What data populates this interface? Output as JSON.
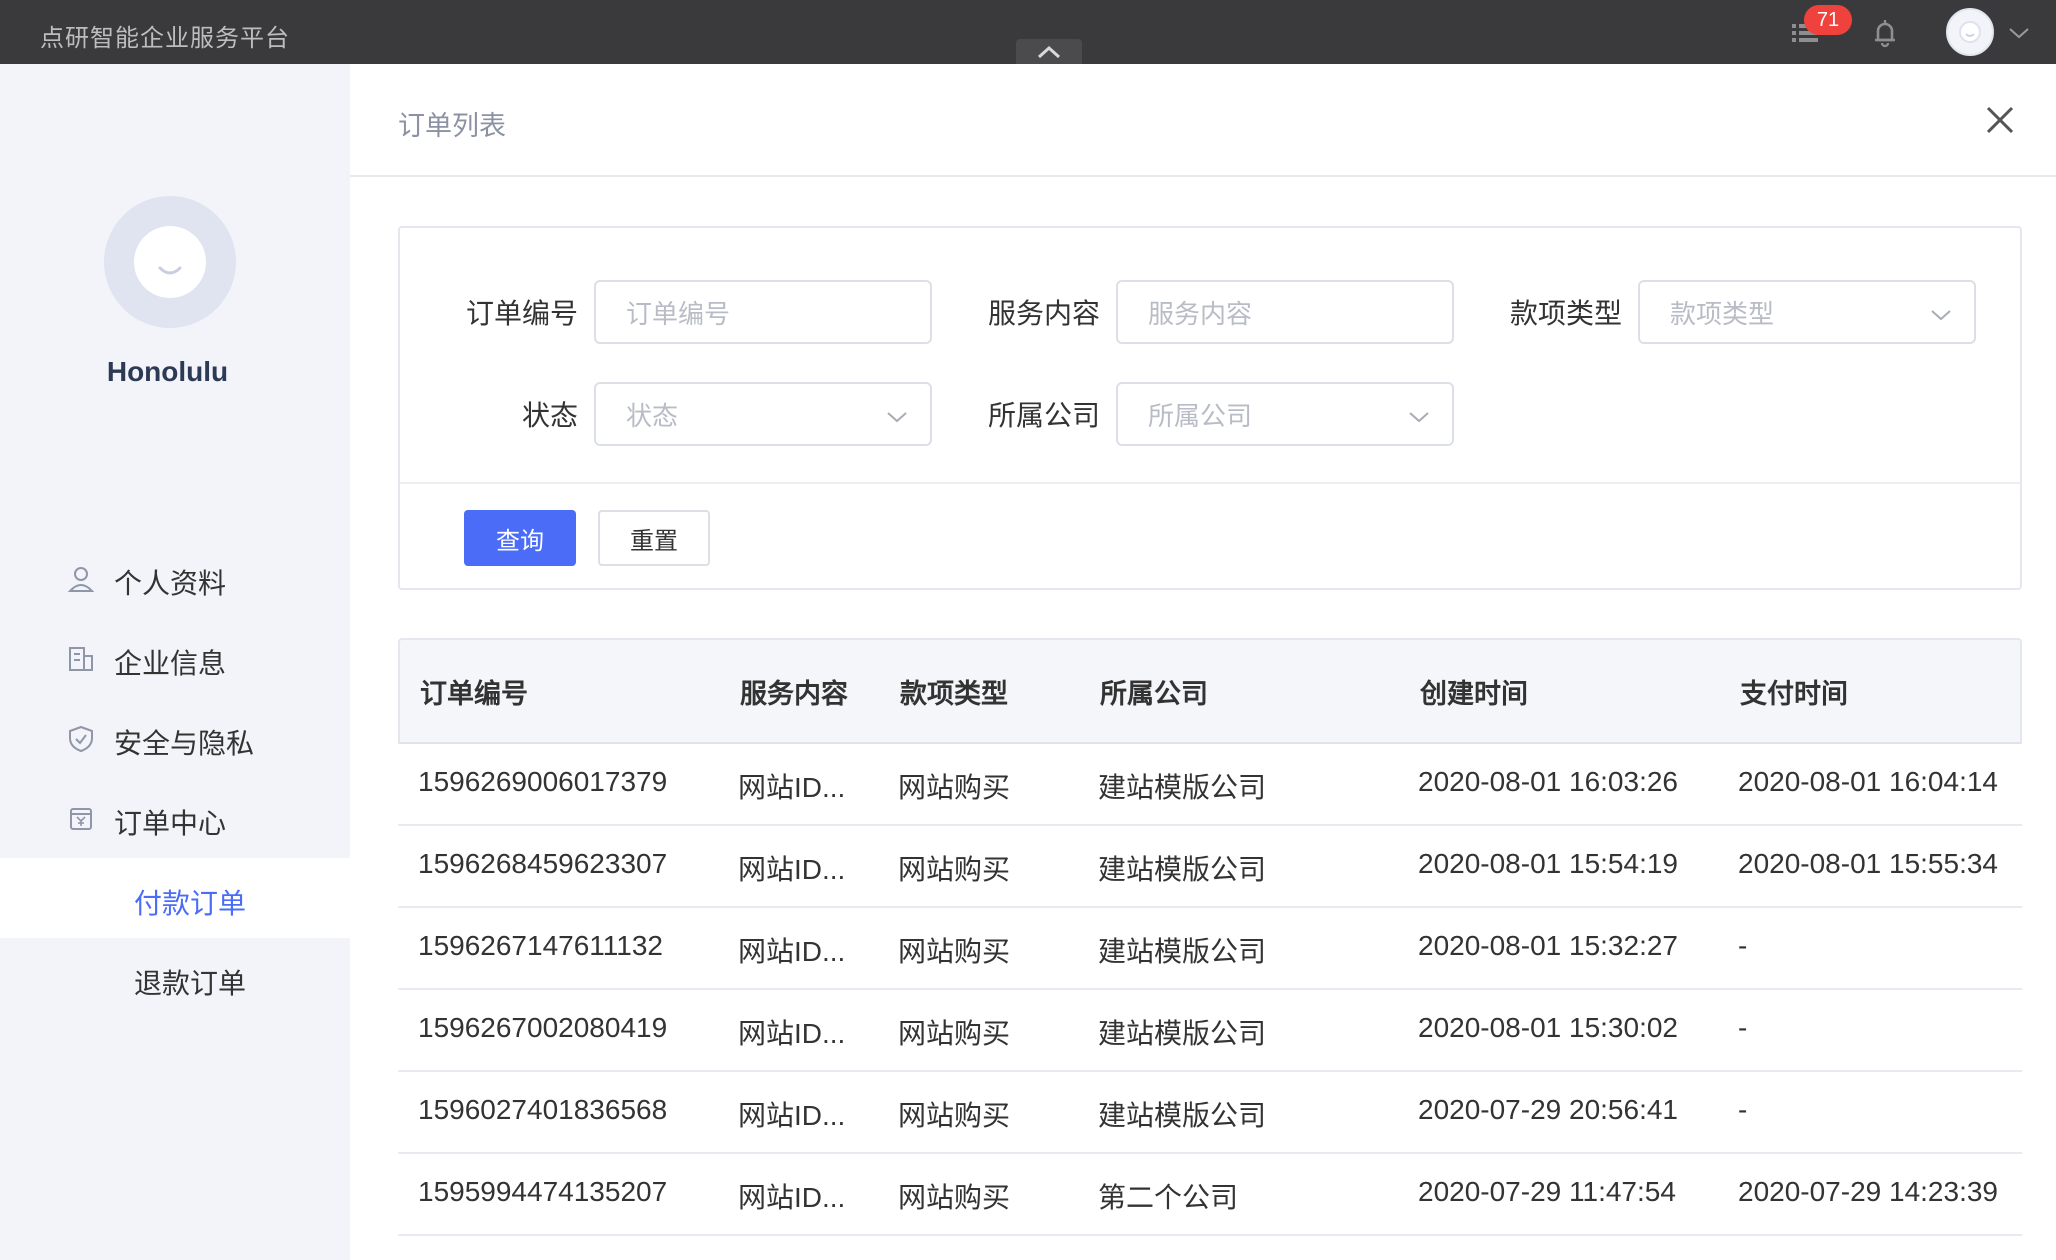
{
  "app": {
    "title": "点研智能企业服务平台"
  },
  "header": {
    "notification_count": "71"
  },
  "user": {
    "name": "Honolulu"
  },
  "sidebar": {
    "items": [
      {
        "label": "个人资料",
        "icon": "user-icon"
      },
      {
        "label": "企业信息",
        "icon": "building-icon"
      },
      {
        "label": "安全与隐私",
        "icon": "shield-icon"
      },
      {
        "label": "订单中心",
        "icon": "yen-card-icon"
      }
    ],
    "subitems": [
      {
        "label": "付款订单",
        "active": true
      },
      {
        "label": "退款订单",
        "active": false
      }
    ]
  },
  "page": {
    "title": "订单列表"
  },
  "filters": {
    "order_no": {
      "label": "订单编号",
      "placeholder": "订单编号"
    },
    "service": {
      "label": "服务内容",
      "placeholder": "服务内容"
    },
    "payment_type": {
      "label": "款项类型",
      "placeholder": "款项类型"
    },
    "status": {
      "label": "状态",
      "placeholder": "状态"
    },
    "company": {
      "label": "所属公司",
      "placeholder": "所属公司"
    },
    "query_label": "查询",
    "reset_label": "重置"
  },
  "table": {
    "columns": [
      "订单编号",
      "服务内容",
      "款项类型",
      "所属公司",
      "创建时间",
      "支付时间"
    ],
    "rows": [
      [
        "1596269006017379",
        "网站ID...",
        "网站购买",
        "建站模版公司",
        "2020-08-01 16:03:26",
        "2020-08-01 16:04:14"
      ],
      [
        "1596268459623307",
        "网站ID...",
        "网站购买",
        "建站模版公司",
        "2020-08-01 15:54:19",
        "2020-08-01 15:55:34"
      ],
      [
        "1596267147611132",
        "网站ID...",
        "网站购买",
        "建站模版公司",
        "2020-08-01 15:32:27",
        "-"
      ],
      [
        "1596267002080419",
        "网站ID...",
        "网站购买",
        "建站模版公司",
        "2020-08-01 15:30:02",
        "-"
      ],
      [
        "1596027401836568",
        "网站ID...",
        "网站购买",
        "建站模版公司",
        "2020-07-29 20:56:41",
        "-"
      ],
      [
        "1595994474135207",
        "网站ID...",
        "网站购买",
        "第二个公司",
        "2020-07-29 11:47:54",
        "2020-07-29 14:23:39"
      ]
    ]
  },
  "colors": {
    "accent": "#4a6cf7",
    "topbar": "#3a3a3c",
    "badge": "#f0423d",
    "sidebar_bg": "#f2f4f9"
  }
}
